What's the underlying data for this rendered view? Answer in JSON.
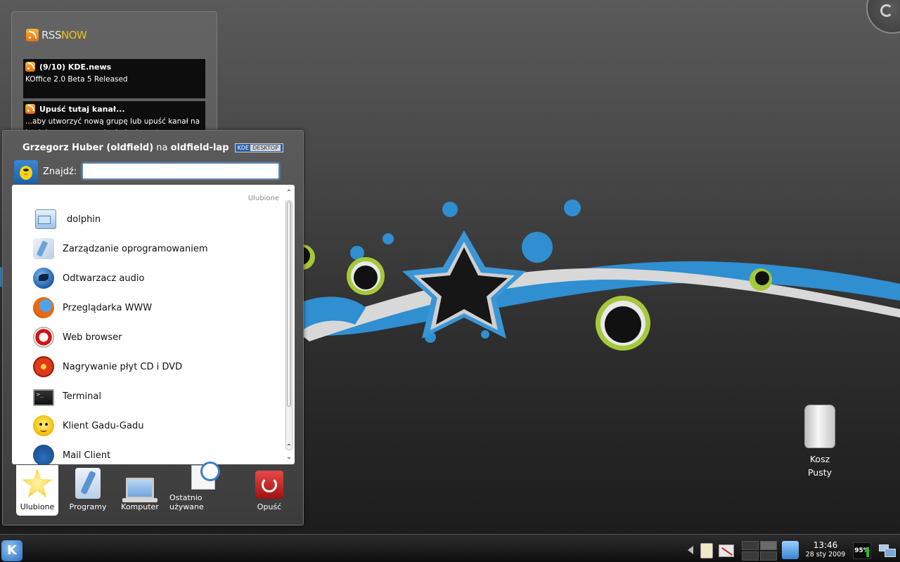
{
  "rss_widget": {
    "brand_rss": "RSS",
    "brand_now": "NOW",
    "feeds": [
      {
        "title": "(9/10) KDE.news",
        "text": "KOffice 2.0 Beta 5 Released"
      },
      {
        "title": "Upuść tutaj kanał...",
        "text": "...aby utworzyć nową grupę lub upuść kanał na istniejącą grupę w celu dodania go tam"
      }
    ]
  },
  "menu": {
    "user_name": "Grzegorz Huber (oldfield)",
    "host_prefix": "na",
    "host": "oldfield-lap",
    "badge_kde": "KDE",
    "badge_desktop": "DESKTOP",
    "search_label": "Znajdź:",
    "search_value": "",
    "favorites_header": "Ulubione",
    "favorites": [
      {
        "label": "dolphin",
        "icon": "dolphin-file-manager-icon"
      },
      {
        "label": "Zarządzanie oprogramowaniem",
        "icon": "software-management-icon"
      },
      {
        "label": "Odtwarzacz audio",
        "icon": "amarok-audio-icon"
      },
      {
        "label": "Przeglądarka WWW",
        "icon": "firefox-icon"
      },
      {
        "label": "Web browser",
        "icon": "opera-icon"
      },
      {
        "label": "Nagrywanie płyt CD i DVD",
        "icon": "cd-burner-icon"
      },
      {
        "label": "Terminal",
        "icon": "terminal-icon"
      },
      {
        "label": "Klient Gadu-Gadu",
        "icon": "gadu-gadu-icon"
      },
      {
        "label": "Mail Client",
        "icon": "thunderbird-mail-icon"
      }
    ],
    "tabs": [
      {
        "label": "Ulubione",
        "icon": "star-icon",
        "active": true
      },
      {
        "label": "Programy",
        "icon": "applications-icon",
        "active": false
      },
      {
        "label": "Komputer",
        "icon": "computer-icon",
        "active": false
      },
      {
        "label": "Ostatnio używane",
        "icon": "recent-documents-icon",
        "active": false
      },
      {
        "label": "Opuść",
        "icon": "power-icon",
        "active": false
      }
    ]
  },
  "desktop": {
    "trash_line1": "Kosz",
    "trash_line2": "Pusty"
  },
  "panel": {
    "clock_time": "13:46",
    "clock_date": "28 sty 2009",
    "battery": "95%"
  },
  "colors": {
    "accent_blue": "#2a8fd0",
    "accent_green": "#9dbb2f",
    "rss_now": "#f2c318"
  }
}
